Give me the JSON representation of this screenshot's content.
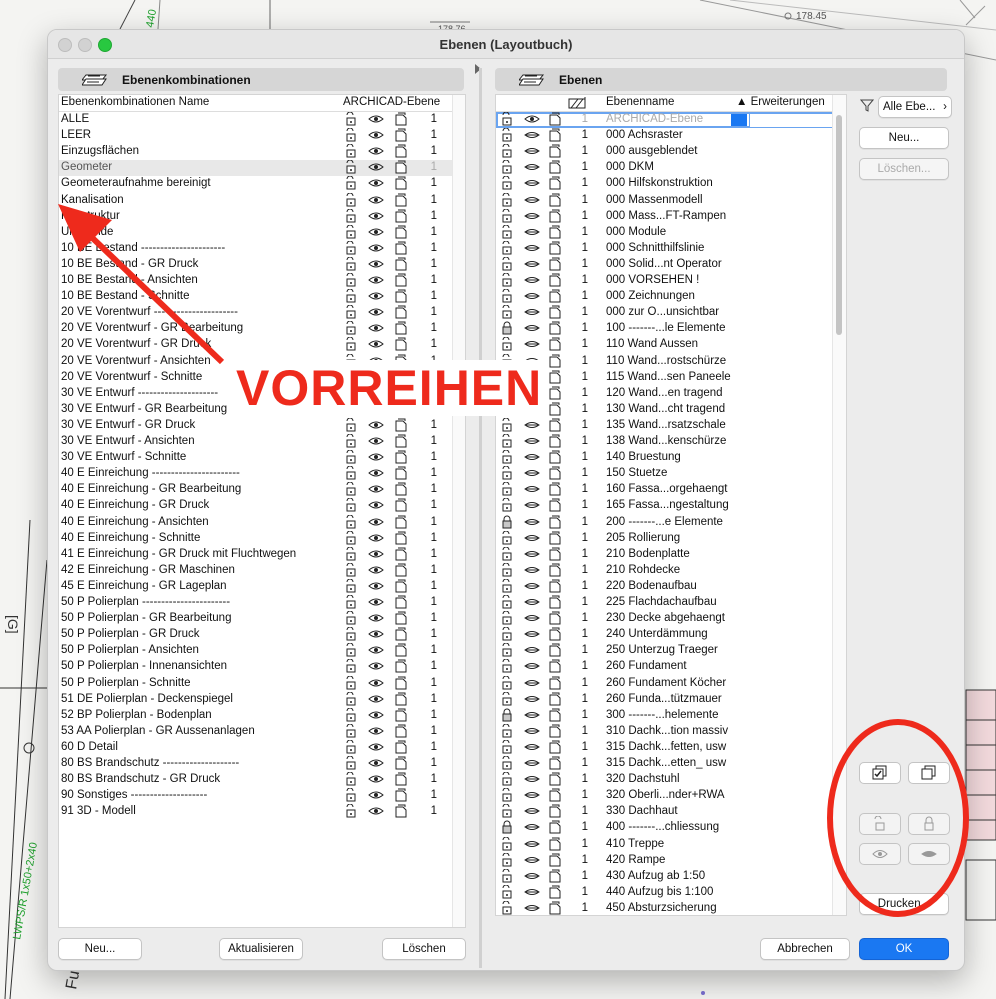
{
  "window": {
    "title": "Ebenen (Layoutbuch)"
  },
  "left_panel": {
    "title": "Ebenenkombinationen",
    "col_name": "Ebenenkombinationen Name",
    "col_level": "ARCHICAD-Ebene",
    "rows": [
      {
        "name": " ALLE",
        "num": "1"
      },
      {
        "name": " LEER",
        "num": "1"
      },
      {
        "name": "Einzugsflächen",
        "num": "1"
      },
      {
        "name": "Geometer",
        "num": "1"
      },
      {
        "name": "Geometeraufnahme bereinigt",
        "num": "1"
      },
      {
        "name": "Kanalisation",
        "num": "1"
      },
      {
        "name": "Konstruktur",
        "num": "1"
      },
      {
        "name": "Umstände",
        "num": "1"
      },
      {
        "name": "10 BE Bestand  ----------------------",
        "num": "1"
      },
      {
        "name": "10 BE Bestand -  GR Druck",
        "num": "1"
      },
      {
        "name": "10 BE Bestand - Ansichten",
        "num": "1"
      },
      {
        "name": "10 BE Bestand - Schnitte",
        "num": "1"
      },
      {
        "name": "20 VE Vorentwurf  ----------------------",
        "num": "1"
      },
      {
        "name": "20 VE Vorentwurf -  GR Bearbeitung",
        "num": "1"
      },
      {
        "name": "20 VE Vorentwurf -  GR Druck",
        "num": "1"
      },
      {
        "name": "20 VE Vorentwurf - Ansichten",
        "num": "1"
      },
      {
        "name": "20 VE Vorentwurf - Schnitte",
        "num": "1"
      },
      {
        "name": "30 VE Entwurf  ---------------------",
        "num": "1"
      },
      {
        "name": "30 VE Entwurf -  GR Bearbeitung",
        "num": "1"
      },
      {
        "name": "30 VE Entwurf -  GR Druck",
        "num": "1"
      },
      {
        "name": "30 VE Entwurf - Ansichten",
        "num": "1"
      },
      {
        "name": "30 VE Entwurf - Schnitte",
        "num": "1"
      },
      {
        "name": "40 E Einreichung  -----------------------",
        "num": "1"
      },
      {
        "name": "40 E Einreichung -   GR Bearbeitung",
        "num": "1"
      },
      {
        "name": "40 E Einreichung -   GR Druck",
        "num": "1"
      },
      {
        "name": "40 E Einreichung - Ansichten",
        "num": "1"
      },
      {
        "name": "40 E Einreichung - Schnitte",
        "num": "1"
      },
      {
        "name": "41 E Einreichung -   GR Druck mit Fluchtwegen",
        "num": "1"
      },
      {
        "name": "42 E Einreichung -   GR Maschinen",
        "num": "1"
      },
      {
        "name": "45 E Einreichung -   GR Lageplan",
        "num": "1"
      },
      {
        "name": "50 P Polierplan  -----------------------",
        "num": "1"
      },
      {
        "name": "50 P Polierplan -   GR Bearbeitung",
        "num": "1"
      },
      {
        "name": "50 P Polierplan -   GR Druck",
        "num": "1"
      },
      {
        "name": "50 P Polierplan -  Ansichten",
        "num": "1"
      },
      {
        "name": "50 P Polierplan -  Innenansichten",
        "num": "1"
      },
      {
        "name": "50 P Polierplan -  Schnitte",
        "num": "1"
      },
      {
        "name": "51 DE Polierplan - Deckenspiegel",
        "num": "1"
      },
      {
        "name": "52 BP Polierplan - Bodenplan",
        "num": "1"
      },
      {
        "name": "53 AA Polierplan -  GR Aussenanlagen",
        "num": "1"
      },
      {
        "name": "60 D Detail",
        "num": "1"
      },
      {
        "name": "80 BS Brandschutz  --------------------",
        "num": "1"
      },
      {
        "name": "80 BS Brandschutz -  GR Druck",
        "num": "1"
      },
      {
        "name": "90 Sonstiges  --------------------",
        "num": "1"
      },
      {
        "name": "91 3D - Modell",
        "num": "1"
      }
    ],
    "buttons": {
      "new": "Neu...",
      "update": "Aktualisieren",
      "delete": "Löschen"
    }
  },
  "right_panel": {
    "title": "Ebenen",
    "col_name": "Ebenenname",
    "col_ext": "▲ Erweiterungen",
    "filter_label": "Alle Ebe...",
    "edit_row": {
      "num": "1",
      "name": "ARCHICAD-Ebene"
    },
    "rows": [
      {
        "name": "000 Achsraster",
        "num": "1",
        "locked": false
      },
      {
        "name": "000 ausgeblendet",
        "num": "1",
        "locked": false
      },
      {
        "name": "000 DKM",
        "num": "1",
        "locked": false
      },
      {
        "name": "000 Hilfskonstruktion",
        "num": "1",
        "locked": false
      },
      {
        "name": "000 Massenmodell",
        "num": "1",
        "locked": false
      },
      {
        "name": "000 Mass...FT-Rampen",
        "num": "1",
        "locked": false
      },
      {
        "name": "000 Module",
        "num": "1",
        "locked": false
      },
      {
        "name": "000 Schnitthilfslinie",
        "num": "1",
        "locked": false
      },
      {
        "name": "000 Solid...nt Operator",
        "num": "1",
        "locked": false
      },
      {
        "name": "000 VORSEHEN !",
        "num": "1",
        "locked": false
      },
      {
        "name": "000 Zeichnungen",
        "num": "1",
        "locked": false
      },
      {
        "name": "000 zur O...unsichtbar",
        "num": "1",
        "locked": false
      },
      {
        "name": "100 -------...le Elemente",
        "num": "1",
        "locked": true
      },
      {
        "name": "110 Wand Aussen",
        "num": "1",
        "locked": false
      },
      {
        "name": "110 Wand...rostschürze",
        "num": "1",
        "locked": false
      },
      {
        "name": "115 Wand...sen Paneele",
        "num": "1",
        "locked": false
      },
      {
        "name": "120 Wand...en tragend",
        "num": "1",
        "locked": false
      },
      {
        "name": "130 Wand...cht tragend",
        "num": "1",
        "locked": false
      },
      {
        "name": "135 Wand...rsatzschale",
        "num": "1",
        "locked": false
      },
      {
        "name": "138 Wand...kenschürze",
        "num": "1",
        "locked": false
      },
      {
        "name": "140 Bruestung",
        "num": "1",
        "locked": false
      },
      {
        "name": "150 Stuetze",
        "num": "1",
        "locked": false
      },
      {
        "name": "160 Fassa...orgehaengt",
        "num": "1",
        "locked": false
      },
      {
        "name": "165 Fassa...ngestaltung",
        "num": "1",
        "locked": false
      },
      {
        "name": "200 -------...e Elemente",
        "num": "1",
        "locked": true
      },
      {
        "name": "205 Rollierung",
        "num": "1",
        "locked": false
      },
      {
        "name": "210 Bodenplatte",
        "num": "1",
        "locked": false
      },
      {
        "name": "210 Rohdecke",
        "num": "1",
        "locked": false
      },
      {
        "name": "220 Bodenaufbau",
        "num": "1",
        "locked": false
      },
      {
        "name": "225 Flachdachaufbau",
        "num": "1",
        "locked": false
      },
      {
        "name": "230 Decke abgehaengt",
        "num": "1",
        "locked": false
      },
      {
        "name": "240 Unterdämmung",
        "num": "1",
        "locked": false
      },
      {
        "name": "250 Unterzug Traeger",
        "num": "1",
        "locked": false
      },
      {
        "name": "260 Fundament",
        "num": "1",
        "locked": false
      },
      {
        "name": "260 Fundament Köcher",
        "num": "1",
        "locked": false
      },
      {
        "name": "260 Funda...tützmauer",
        "num": "1",
        "locked": false
      },
      {
        "name": "300 -------...helemente",
        "num": "1",
        "locked": true
      },
      {
        "name": "310 Dachk...tion massiv",
        "num": "1",
        "locked": false
      },
      {
        "name": "315 Dachk...fetten, usw",
        "num": "1",
        "locked": false
      },
      {
        "name": "315 Dachk...etten_ usw",
        "num": "1",
        "locked": false
      },
      {
        "name": "320 Dachstuhl",
        "num": "1",
        "locked": false
      },
      {
        "name": "320 Oberli...nder+RWA",
        "num": "1",
        "locked": false
      },
      {
        "name": "330 Dachhaut",
        "num": "1",
        "locked": false
      },
      {
        "name": "400 -------...chliessung",
        "num": "1",
        "locked": true
      },
      {
        "name": "410 Treppe",
        "num": "1",
        "locked": false
      },
      {
        "name": "420 Rampe",
        "num": "1",
        "locked": false
      },
      {
        "name": "430 Aufzug ab 1:50",
        "num": "1",
        "locked": false
      },
      {
        "name": "440 Aufzug bis 1:100",
        "num": "1",
        "locked": false
      },
      {
        "name": "450 Absturzsicherung",
        "num": "1",
        "locked": false
      }
    ],
    "buttons": {
      "new": "Neu...",
      "delete": "Löschen...",
      "print": "Drucken...",
      "cancel": "Abbrechen",
      "ok": "OK"
    }
  },
  "annotation": {
    "text": "VORREIHEN",
    "color": "#ee2a1c"
  },
  "background_labels": {
    "elev1": "178.76",
    "elev2": "178.45"
  },
  "colors": {
    "accent": "#1a78f2",
    "annotation": "#ee2a1c"
  }
}
